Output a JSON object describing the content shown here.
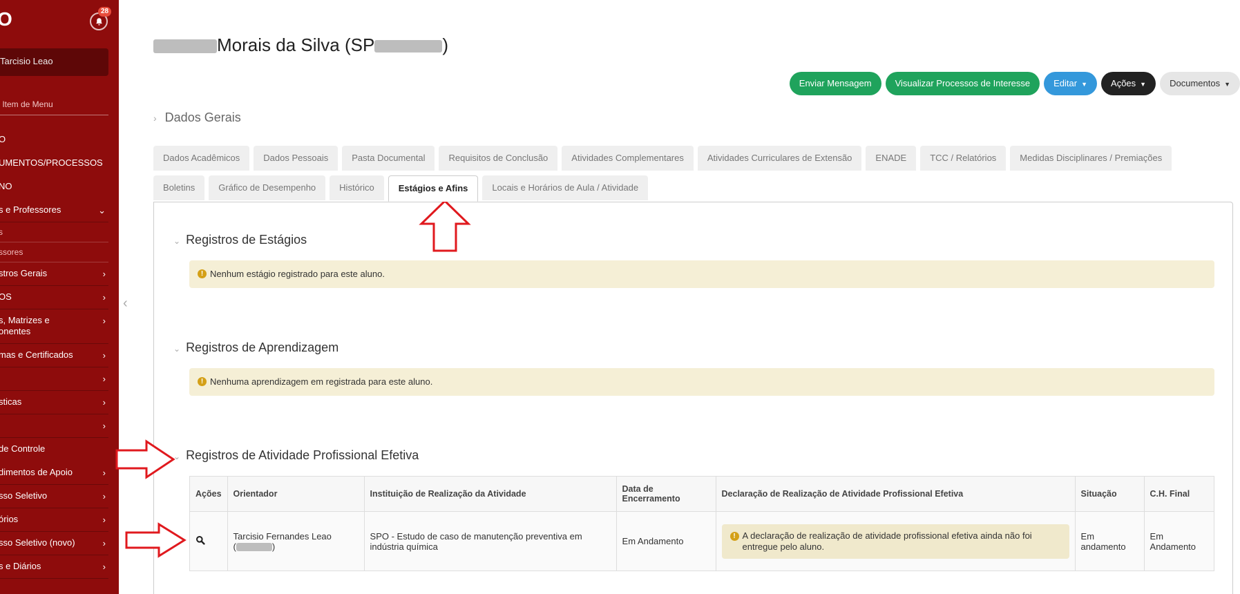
{
  "sidebar": {
    "brand": "O",
    "notifications_count": "28",
    "user_name": "Tarcisio Leao",
    "search_placeholder": "r Item de Menu",
    "items": [
      {
        "label": "O",
        "kind": "plain"
      },
      {
        "label": "UMENTOS/PROCESSOS",
        "kind": "plain"
      },
      {
        "label": "NO",
        "kind": "plain"
      },
      {
        "label": "s e Professores",
        "kind": "open"
      },
      {
        "label": "s",
        "kind": "sub"
      },
      {
        "label": "ssores",
        "kind": "sub"
      },
      {
        "label": "stros Gerais",
        "kind": "item"
      },
      {
        "label": "OS",
        "kind": "item"
      },
      {
        "label": "s, Matrizes e onentes",
        "kind": "two"
      },
      {
        "label": "mas e Certificados",
        "kind": "item"
      },
      {
        "label": "",
        "kind": "item"
      },
      {
        "label": "sticas",
        "kind": "item"
      },
      {
        "label": "",
        "kind": "item"
      },
      {
        "label": "de Controle",
        "kind": "plain"
      },
      {
        "label": "dimentos de Apoio",
        "kind": "item"
      },
      {
        "label": "sso Seletivo",
        "kind": "item"
      },
      {
        "label": "órios",
        "kind": "item"
      },
      {
        "label": "sso Seletivo (novo)",
        "kind": "item"
      },
      {
        "label": "s e Diários",
        "kind": "item"
      }
    ]
  },
  "header": {
    "title": "Morais da Silva (SP",
    "title_suffix": ")"
  },
  "actions": {
    "send_message": "Enviar Mensagem",
    "view_processes": "Visualizar Processos de Interesse",
    "edit": "Editar",
    "actions": "Ações",
    "documents": "Documentos"
  },
  "section": {
    "title": "Dados Gerais"
  },
  "tabs_row1": [
    "Dados Acadêmicos",
    "Dados Pessoais",
    "Pasta Documental",
    "Requisitos de Conclusão",
    "Atividades Complementares",
    "Atividades Curriculares de Extensão",
    "ENADE",
    "TCC / Relatórios",
    "Medidas Disciplinares / Premiações"
  ],
  "tabs_row2": [
    "Boletins",
    "Gráfico de Desempenho",
    "Histórico",
    "Estágios e Afins",
    "Locais e Horários de Aula / Atividade"
  ],
  "active_tab": "Estágios e Afins",
  "blocks": {
    "estagios": {
      "title": "Registros de Estágios",
      "alert": "Nenhum estágio registrado para este aluno."
    },
    "aprendizagem": {
      "title": "Registros de Aprendizagem",
      "alert": "Nenhuma aprendizagem em registrada para este aluno."
    },
    "atividade": {
      "title": "Registros de Atividade Profissional Efetiva"
    }
  },
  "table": {
    "headers": [
      "Ações",
      "Orientador",
      "Instituição de Realização da Atividade",
      "Data de Encerramento",
      "Declaração de Realização de Atividade Profissional Efetiva",
      "Situação",
      "C.H. Final"
    ],
    "row": {
      "orientador": "Tarcisio Fernandes Leao",
      "orientador_paren_open": "(",
      "orientador_paren_close": ")",
      "instituicao": "SPO - Estudo de caso de manutenção preventiva em indústria química",
      "data_encerramento": "Em Andamento",
      "declaracao": "A declaração de realização de atividade profissional efetiva ainda não foi entregue pelo aluno.",
      "situacao": "Em andamento",
      "ch_final": "Em Andamento"
    }
  },
  "colors": {
    "sidebar": "#8e0c0c",
    "green": "#1fa35c",
    "blue": "#3498db",
    "annotation": "#e0191e"
  }
}
